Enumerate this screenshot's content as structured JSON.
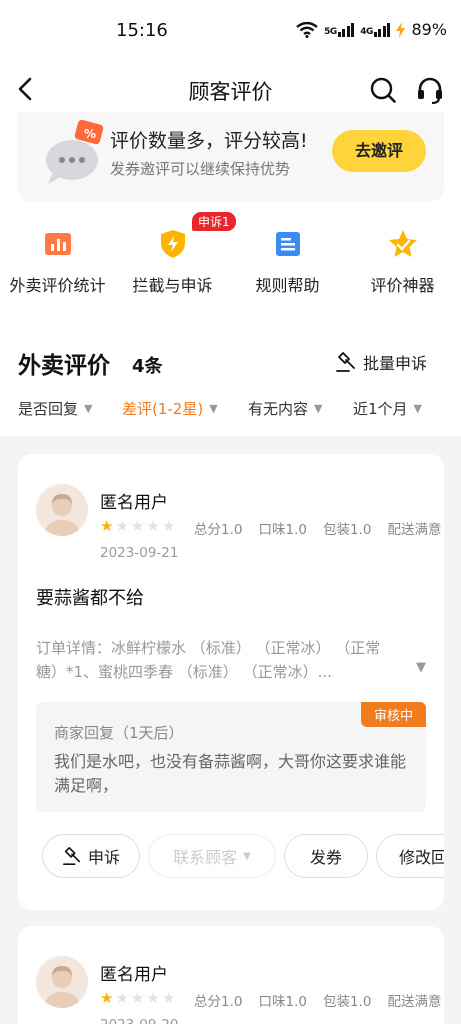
{
  "status_bar": {
    "time": "15:16",
    "network1": "5G",
    "network2": "4G",
    "battery": "89%"
  },
  "header": {
    "title": "顾客评价",
    "back_icon": "chevron-left-icon",
    "search_icon": "search-icon",
    "service_icon": "headset-icon"
  },
  "banner": {
    "title": "评价数量多，评分较高!",
    "subtitle": "发券邀评可以继续保持优势",
    "button": "去邀评",
    "accent": "#ffd43b"
  },
  "entries": [
    {
      "label": "外卖评价统计",
      "icon": "bar-chart-icon"
    },
    {
      "label": "拦截与申诉",
      "icon": "shield-bolt-icon",
      "badge": "申诉1"
    },
    {
      "label": "规则帮助",
      "icon": "document-icon"
    },
    {
      "label": "评价神器",
      "icon": "star-icon"
    }
  ],
  "section": {
    "title": "外卖评价",
    "count": "4条",
    "batch_label": "批量申诉"
  },
  "filters": [
    {
      "label": "是否回复",
      "active": false
    },
    {
      "label": "差评(1-2星)",
      "active": true
    },
    {
      "label": "有无内容",
      "active": false
    },
    {
      "label": "近1个月",
      "active": false
    }
  ],
  "reviews": [
    {
      "user": "匿名用户",
      "stars": 1,
      "total": "总分1.0",
      "taste": "口味1.0",
      "pack": "包装1.0",
      "delivery": "配送满意",
      "date": "2023-09-21",
      "comment": "要蒜酱都不给",
      "order_line1": "订单详情：冰鲜柠檬水 （标准） （正常冰） （正常",
      "order_line2": "糖）*1、蜜桃四季春 （标准） （正常冰）...",
      "reply_status": "审核中",
      "reply_title": "商家回复（1天后）",
      "reply_text": "我们是水吧，也没有备蒜酱啊，大哥你这要求谁能满足啊，",
      "actions": {
        "appeal": "申诉",
        "contact": "联系顾客",
        "coupon": "发券",
        "edit": "修改回复"
      }
    },
    {
      "user": "匿名用户",
      "stars": 1,
      "total": "总分1.0",
      "taste": "口味1.0",
      "pack": "包装1.0",
      "delivery": "配送满意",
      "date": "2023-09-20"
    }
  ],
  "colors": {
    "accent_orange": "#f07c1e",
    "badge_red": "#e8262b",
    "star": "#f7b500"
  }
}
